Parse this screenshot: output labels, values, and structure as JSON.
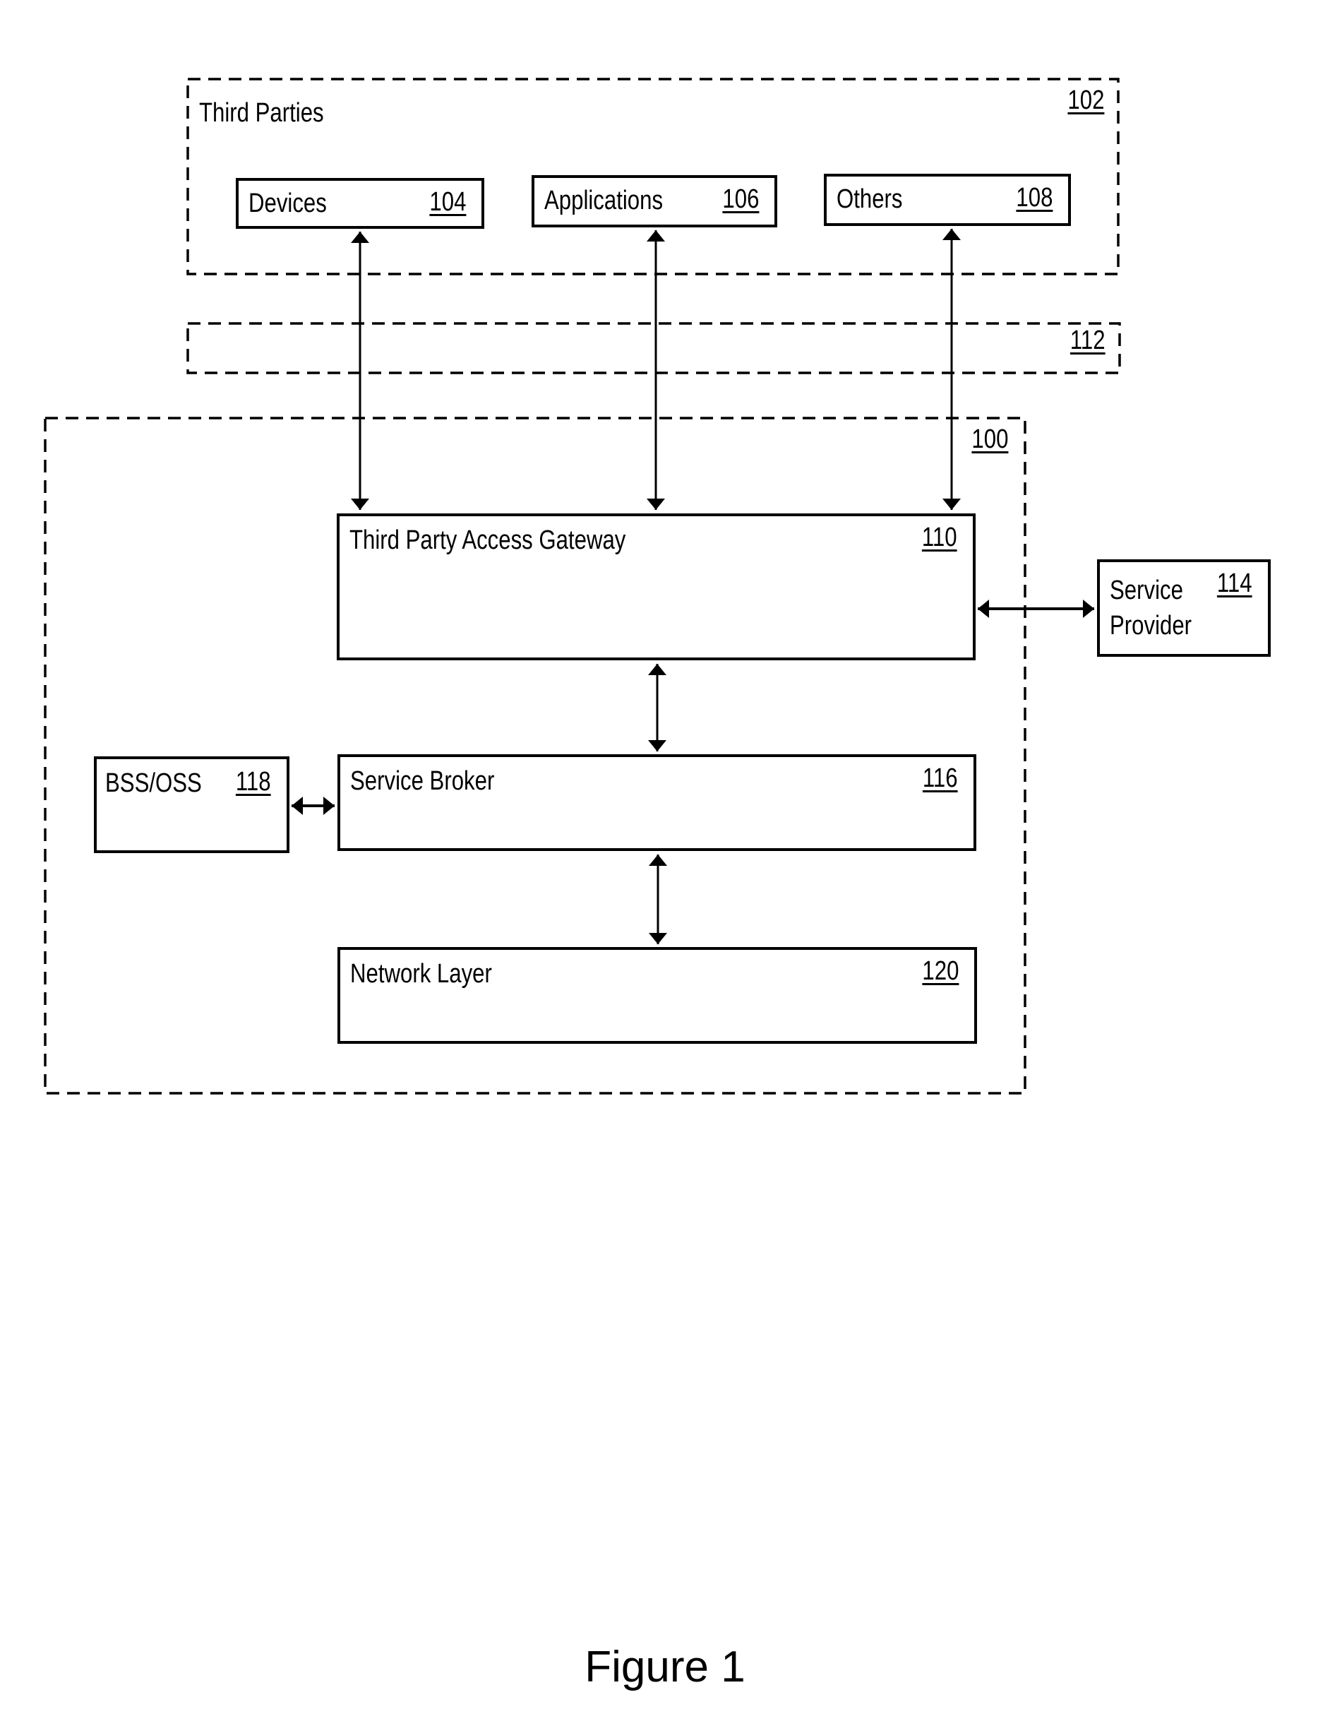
{
  "figure": {
    "caption": "Figure 1"
  },
  "components": {
    "third_parties": {
      "label": "Third Parties",
      "ref": "102",
      "style": "dashed"
    },
    "devices": {
      "label": "Devices",
      "ref": "104"
    },
    "applications": {
      "label": "Applications",
      "ref": "106"
    },
    "others": {
      "label": "Others",
      "ref": "108"
    },
    "layer_112": {
      "label": "",
      "ref": "112",
      "style": "dashed"
    },
    "system_100": {
      "label": "",
      "ref": "100",
      "style": "dashed"
    },
    "gateway": {
      "label": "Third Party Access Gateway",
      "ref": "110"
    },
    "service_provider": {
      "label_line1": "Service",
      "label_line2": "Provider",
      "ref": "114"
    },
    "bss_oss": {
      "label": "BSS/OSS",
      "ref": "118"
    },
    "service_broker": {
      "label": "Service Broker",
      "ref": "116"
    },
    "network_layer": {
      "label": "Network Layer",
      "ref": "120"
    }
  },
  "connections": [
    {
      "from": "104",
      "to": "110",
      "type": "bidirectional"
    },
    {
      "from": "106",
      "to": "110",
      "type": "bidirectional"
    },
    {
      "from": "108",
      "to": "110",
      "type": "bidirectional"
    },
    {
      "from": "110",
      "to": "114",
      "type": "bidirectional"
    },
    {
      "from": "110",
      "to": "116",
      "type": "bidirectional"
    },
    {
      "from": "118",
      "to": "116",
      "type": "bidirectional"
    },
    {
      "from": "116",
      "to": "120",
      "type": "bidirectional"
    }
  ]
}
